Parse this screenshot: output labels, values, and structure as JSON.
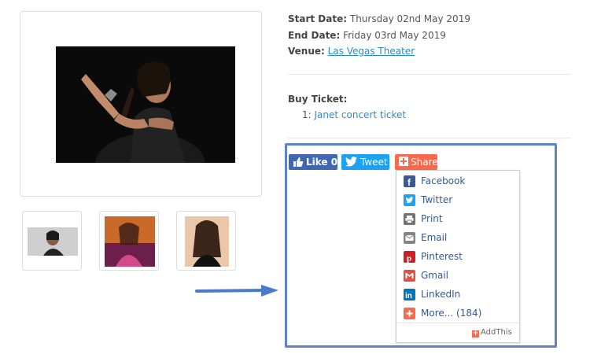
{
  "event": {
    "start_label": "Start Date:",
    "start_value": "Thursday 02nd May 2019",
    "end_label": "End Date:",
    "end_value": "Friday 03rd May 2019",
    "venue_label": "Venue:",
    "venue_value": "Las Vegas Theater"
  },
  "tickets": {
    "heading": "Buy Ticket:",
    "items": [
      {
        "index": "1:",
        "label": "Janet concert ticket"
      }
    ]
  },
  "social": {
    "like_label": "Like",
    "like_count": "0",
    "tweet_label": "Tweet",
    "share_label": "Share"
  },
  "share_menu": {
    "items": [
      {
        "label": "Facebook",
        "icon": "facebook-icon",
        "color": "#3b5998"
      },
      {
        "label": "Twitter",
        "icon": "twitter-icon",
        "color": "#1da1f2"
      },
      {
        "label": "Print",
        "icon": "print-icon",
        "color": "#737373"
      },
      {
        "label": "Email",
        "icon": "email-icon",
        "color": "#848484"
      },
      {
        "label": "Pinterest",
        "icon": "pinterest-icon",
        "color": "#cb2027"
      },
      {
        "label": "Gmail",
        "icon": "gmail-icon",
        "color": "#dd5347"
      },
      {
        "label": "LinkedIn",
        "icon": "linkedin-icon",
        "color": "#0077b5"
      },
      {
        "label": "More... (184)",
        "icon": "plus-icon",
        "color": "#f8694d"
      }
    ],
    "footer": "AddThis"
  },
  "colors": {
    "link": "#2a8bc9",
    "highlight_border": "#5b84c4",
    "arrow": "#4a7bc8"
  }
}
